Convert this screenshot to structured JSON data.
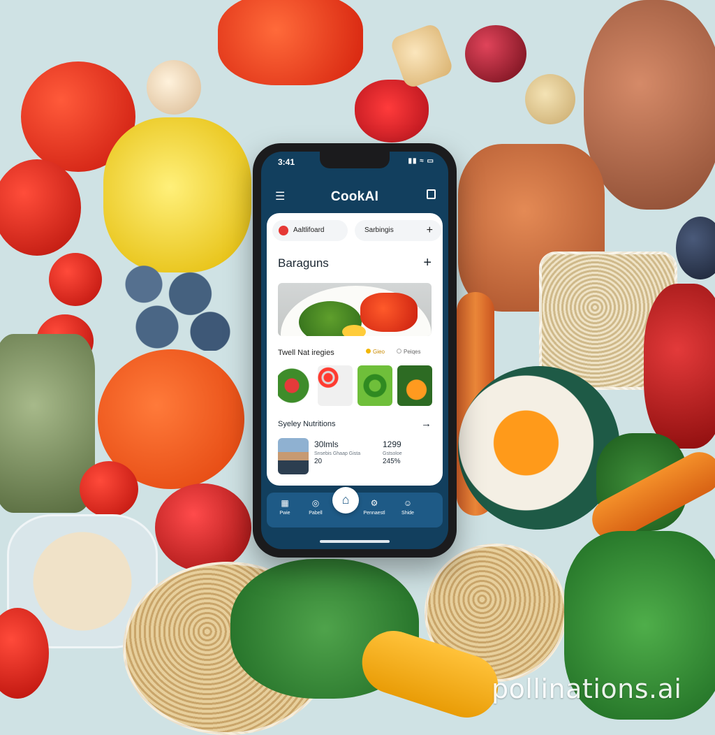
{
  "status_bar": {
    "time": "3:41",
    "icons": "▮▮ ≈ ▭"
  },
  "app": {
    "title": "CookAI",
    "menu_icon": "menu-icon",
    "cart_icon": "cart-icon"
  },
  "tabs": [
    {
      "label": "Aaltlifoard"
    },
    {
      "label": "Sarbingis",
      "action": "+"
    }
  ],
  "recipes_section": {
    "title": "Baraguns",
    "action": "+"
  },
  "row_label": {
    "main": "Twell Nat iregies",
    "tag_a": "Gieo",
    "tag_b": "Peiqes"
  },
  "nutrition_section": {
    "title": "Syeley Nutritions",
    "arrow": "→"
  },
  "stats": {
    "col1": {
      "value": "30lmls",
      "line1": "Snsebis Ghaap Gista",
      "line2": "20"
    },
    "col2": {
      "value": "1299",
      "line1": "Gstsoloe",
      "line2": "245%"
    }
  },
  "bottom_nav": [
    {
      "label": "Pwie",
      "icon": "grid-icon"
    },
    {
      "label": "Pabell",
      "icon": "circle-icon"
    },
    {
      "label": "Pennaestl",
      "icon": "gear-icon"
    },
    {
      "label": "Shide",
      "icon": "user-icon"
    }
  ],
  "home_button_icon": "home-icon",
  "watermark": "pollinations.ai",
  "colors": {
    "app_primary": "#123f5e",
    "tab_bar": "#1e5a86",
    "accent_red": "#e53935",
    "background": "#cfe2e4"
  }
}
